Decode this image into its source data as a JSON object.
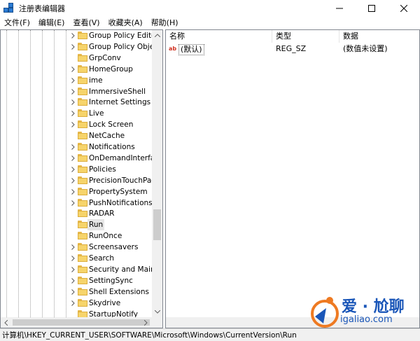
{
  "window": {
    "title": "注册表编辑器"
  },
  "menu": {
    "items": [
      "文件(F)",
      "编辑(E)",
      "查看(V)",
      "收藏夹(A)",
      "帮助(H)"
    ]
  },
  "tree": {
    "items": [
      {
        "label": "Group Policy Editor",
        "expandable": true
      },
      {
        "label": "Group Policy Objec",
        "expandable": true
      },
      {
        "label": "GrpConv",
        "expandable": false
      },
      {
        "label": "HomeGroup",
        "expandable": true
      },
      {
        "label": "ime",
        "expandable": true
      },
      {
        "label": "ImmersiveShell",
        "expandable": true
      },
      {
        "label": "Internet Settings",
        "expandable": true
      },
      {
        "label": "Live",
        "expandable": true
      },
      {
        "label": "Lock Screen",
        "expandable": true
      },
      {
        "label": "NetCache",
        "expandable": false
      },
      {
        "label": "Notifications",
        "expandable": true
      },
      {
        "label": "OnDemandInterface",
        "expandable": true
      },
      {
        "label": "Policies",
        "expandable": true
      },
      {
        "label": "PrecisionTouchPad",
        "expandable": true
      },
      {
        "label": "PropertySystem",
        "expandable": true
      },
      {
        "label": "PushNotifications",
        "expandable": true
      },
      {
        "label": "RADAR",
        "expandable": false
      },
      {
        "label": "Run",
        "expandable": false,
        "selected": true
      },
      {
        "label": "RunOnce",
        "expandable": false
      },
      {
        "label": "Screensavers",
        "expandable": true
      },
      {
        "label": "Search",
        "expandable": true
      },
      {
        "label": "Security and Mainte",
        "expandable": true
      },
      {
        "label": "SettingSync",
        "expandable": true
      },
      {
        "label": "Shell Extensions",
        "expandable": true
      },
      {
        "label": "Skydrive",
        "expandable": true
      },
      {
        "label": "StartupNotify",
        "expandable": false
      }
    ]
  },
  "list": {
    "headers": {
      "name": "名称",
      "type": "类型",
      "data": "数据"
    },
    "rows": [
      {
        "name": "(默认)",
        "type": "REG_SZ",
        "data": "(数值未设置)",
        "icon": "ab-string-icon"
      }
    ]
  },
  "status": {
    "path": "计算机\\HKEY_CURRENT_USER\\SOFTWARE\\Microsoft\\Windows\\CurrentVersion\\Run"
  },
  "watermark": {
    "brand": "爱 · 尬聊",
    "url": "igaliao.com"
  },
  "colors": {
    "folder": "#f6d46b",
    "selection": "#e5e5e5",
    "watermark": "#1a56b8",
    "string_icon": "#d03020"
  }
}
